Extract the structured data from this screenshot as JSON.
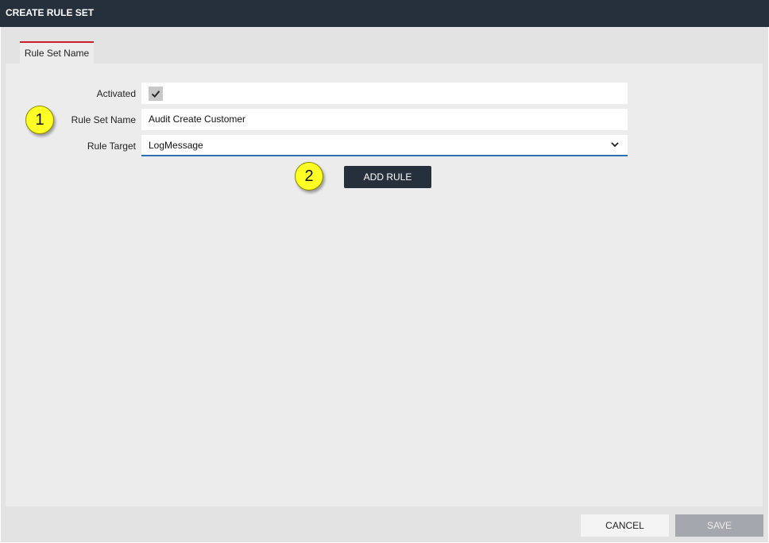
{
  "window": {
    "title": "CREATE RULE SET"
  },
  "tabs": [
    {
      "label": "Rule Set Name",
      "active": true
    }
  ],
  "form": {
    "activated": {
      "label": "Activated",
      "checked": true
    },
    "rule_set_name": {
      "label": "Rule Set Name",
      "value": "Audit Create Customer"
    },
    "rule_target": {
      "label": "Rule Target",
      "value": "LogMessage"
    }
  },
  "actions": {
    "add_rule_label": "ADD RULE"
  },
  "footer": {
    "cancel_label": "CANCEL",
    "save_label": "SAVE"
  },
  "callouts": {
    "first": "1",
    "second": "2"
  },
  "icons": {
    "check": "check-icon",
    "dropdown": "chevron-down-icon"
  },
  "colors": {
    "titlebar": "#26303c",
    "accent_tab": "#c8202a",
    "select_underline": "#2d6fb5",
    "callout": "#ffff26",
    "primary_button": "#26303c",
    "disabled_button": "#a4a8ae"
  }
}
